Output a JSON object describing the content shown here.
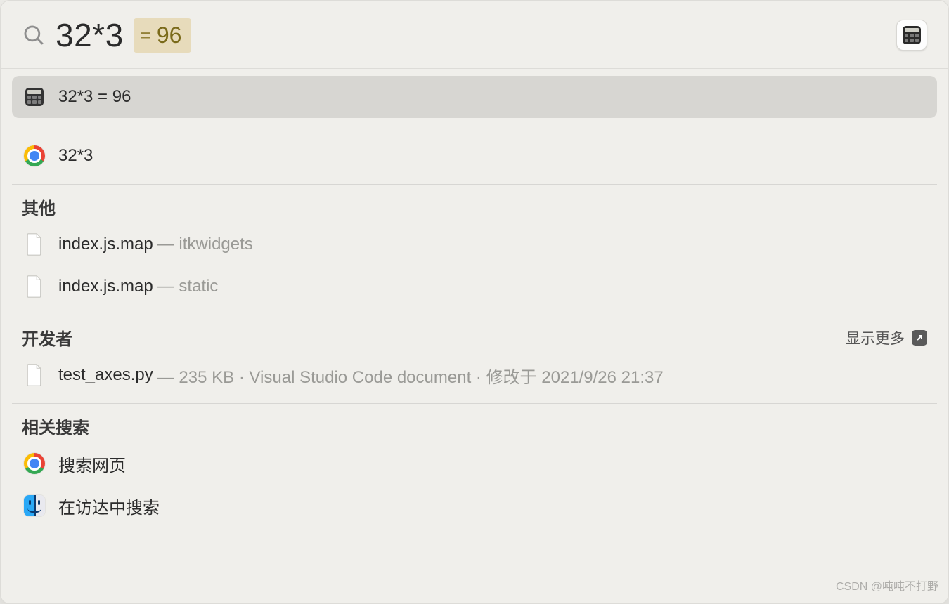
{
  "search": {
    "query": "32*3",
    "result_prefix": "=",
    "result_value": "96"
  },
  "top_hit": {
    "text": "32*3 = 96"
  },
  "web_hit": {
    "text": "32*3"
  },
  "sections": {
    "other": {
      "title": "其他",
      "items": [
        {
          "name": "index.js.map",
          "meta": "— itkwidgets"
        },
        {
          "name": "index.js.map",
          "meta": "— static"
        }
      ]
    },
    "developer": {
      "title": "开发者",
      "show_more": "显示更多",
      "items": [
        {
          "name": "test_axes.py",
          "meta": "— 235 KB · Visual Studio Code document · 修改于 2021/9/26 21:37"
        }
      ]
    },
    "related": {
      "title": "相关搜索",
      "items": [
        {
          "name": "搜索网页"
        },
        {
          "name": "在访达中搜索"
        }
      ]
    }
  },
  "watermark": "CSDN @吨吨不打野"
}
